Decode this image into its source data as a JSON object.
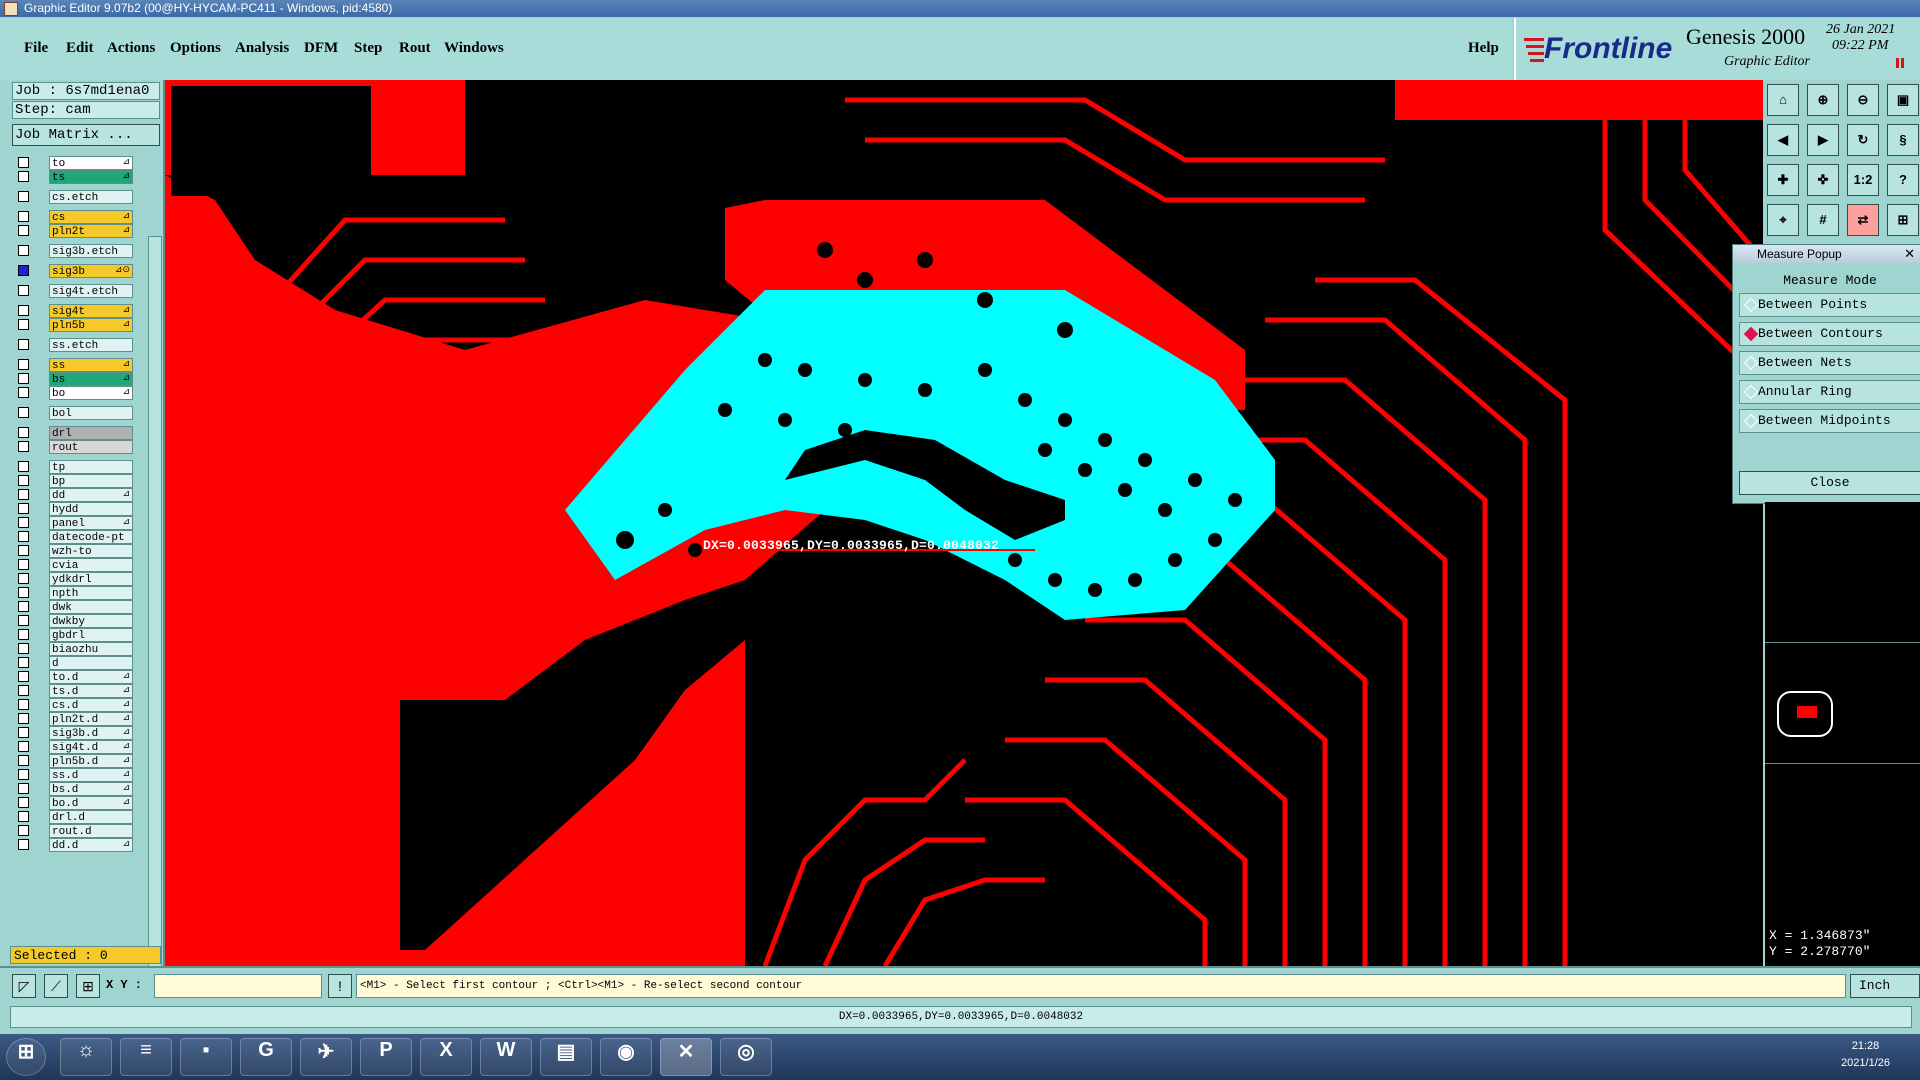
{
  "window": {
    "title": "Graphic Editor 9.07b2 (00@HY-HYCAM-PC411 - Windows, pid:4580)"
  },
  "menu": {
    "items": [
      "File",
      "Edit",
      "Actions",
      "Options",
      "Analysis",
      "DFM",
      "Step",
      "Rout",
      "Windows"
    ],
    "help": "Help"
  },
  "brand": {
    "logo": "Frontline",
    "product": "Genesis 2000",
    "subtitle": "Graphic Editor",
    "date": "26 Jan 2021",
    "time": "09:22 PM"
  },
  "job": {
    "job_label": "Job : 6s7md1ena0",
    "step_label": "Step: cam",
    "matrix_button": "Job Matrix ..."
  },
  "layers": [
    {
      "name": "to",
      "color": "#ffffff",
      "flag": "⊿"
    },
    {
      "name": "ts",
      "color": "#1ea87a",
      "flag": "⊿"
    },
    {
      "name": "cs.etch",
      "color": "#dff4f2",
      "flag": ""
    },
    {
      "name": "cs",
      "color": "#f5c92a",
      "flag": "⊿"
    },
    {
      "name": "pln2t",
      "color": "#f5c92a",
      "flag": "⊿"
    },
    {
      "name": "sig3b.etch",
      "color": "#dff4f2",
      "flag": ""
    },
    {
      "name": "sig3b",
      "color": "#f5c92a",
      "flag": "⊿⊙"
    },
    {
      "name": "sig4t.etch",
      "color": "#dff4f2",
      "flag": ""
    },
    {
      "name": "sig4t",
      "color": "#f5c92a",
      "flag": "⊿"
    },
    {
      "name": "pln5b",
      "color": "#f5c92a",
      "flag": "⊿"
    },
    {
      "name": "ss.etch",
      "color": "#dff4f2",
      "flag": ""
    },
    {
      "name": "ss",
      "color": "#f5c92a",
      "flag": "⊿"
    },
    {
      "name": "bs",
      "color": "#1ea87a",
      "flag": "⊿"
    },
    {
      "name": "bo",
      "color": "#ffffff",
      "flag": "⊿"
    },
    {
      "name": "bol",
      "color": "#dff4f2",
      "flag": ""
    },
    {
      "name": "drl",
      "color": "#b0b0b0",
      "flag": ""
    },
    {
      "name": "rout",
      "color": "#d8d8d8",
      "flag": ""
    },
    {
      "name": "tp",
      "color": "#dff4f2",
      "flag": ""
    },
    {
      "name": "bp",
      "color": "#dff4f2",
      "flag": ""
    },
    {
      "name": "dd",
      "color": "#dff4f2",
      "flag": "⊿"
    },
    {
      "name": "hydd",
      "color": "#dff4f2",
      "flag": ""
    },
    {
      "name": "panel",
      "color": "#dff4f2",
      "flag": "⊿"
    },
    {
      "name": "datecode-pt",
      "color": "#dff4f2",
      "flag": ""
    },
    {
      "name": "wzh-to",
      "color": "#dff4f2",
      "flag": ""
    },
    {
      "name": "cvia",
      "color": "#dff4f2",
      "flag": ""
    },
    {
      "name": "ydkdrl",
      "color": "#dff4f2",
      "flag": ""
    },
    {
      "name": "npth",
      "color": "#dff4f2",
      "flag": ""
    },
    {
      "name": "dwk",
      "color": "#dff4f2",
      "flag": ""
    },
    {
      "name": "dwkby",
      "color": "#dff4f2",
      "flag": ""
    },
    {
      "name": "gbdrl",
      "color": "#dff4f2",
      "flag": ""
    },
    {
      "name": "biaozhu",
      "color": "#dff4f2",
      "flag": ""
    },
    {
      "name": "d",
      "color": "#dff4f2",
      "flag": ""
    },
    {
      "name": "to.d",
      "color": "#dff4f2",
      "flag": "⊿"
    },
    {
      "name": "ts.d",
      "color": "#dff4f2",
      "flag": "⊿"
    },
    {
      "name": "cs.d",
      "color": "#dff4f2",
      "flag": "⊿"
    },
    {
      "name": "pln2t.d",
      "color": "#dff4f2",
      "flag": "⊿"
    },
    {
      "name": "sig3b.d",
      "color": "#dff4f2",
      "flag": "⊿"
    },
    {
      "name": "sig4t.d",
      "color": "#dff4f2",
      "flag": "⊿"
    },
    {
      "name": "pln5b.d",
      "color": "#dff4f2",
      "flag": "⊿"
    },
    {
      "name": "ss.d",
      "color": "#dff4f2",
      "flag": "⊿"
    },
    {
      "name": "bs.d",
      "color": "#dff4f2",
      "flag": "⊿"
    },
    {
      "name": "bo.d",
      "color": "#dff4f2",
      "flag": "⊿"
    },
    {
      "name": "drl.d",
      "color": "#dff4f2",
      "flag": ""
    },
    {
      "name": "rout.d",
      "color": "#dff4f2",
      "flag": ""
    },
    {
      "name": "dd.d",
      "color": "#dff4f2",
      "flag": "⊿"
    }
  ],
  "selected_text": "Selected : 0",
  "canvas": {
    "measure_label": "DX=0.0033965,DY=0.0033965,D=0.0048032",
    "copper_color": "#ff0000",
    "highlight_color": "#00ffff"
  },
  "measure_popup": {
    "title": "Measure Popup",
    "heading": "Measure Mode",
    "options": [
      "Between Points",
      "Between Contours",
      "Between Nets",
      "Annular Ring",
      "Between Midpoints"
    ],
    "selected": "Between Contours",
    "close": "Close"
  },
  "coords": {
    "x": "X = 1.346873\"",
    "y": "Y = 2.278770\""
  },
  "command": {
    "xy_label": "X Y :",
    "xy_value": "",
    "prompt": "<M1> - Select first contour ; <Ctrl><M1> - Re-select second contour",
    "unit": "Inch"
  },
  "status": "DX=0.0033965,DY=0.0033965,D=0.0048032",
  "taskbar": {
    "time": "21:28",
    "date": "2021/1/26"
  }
}
